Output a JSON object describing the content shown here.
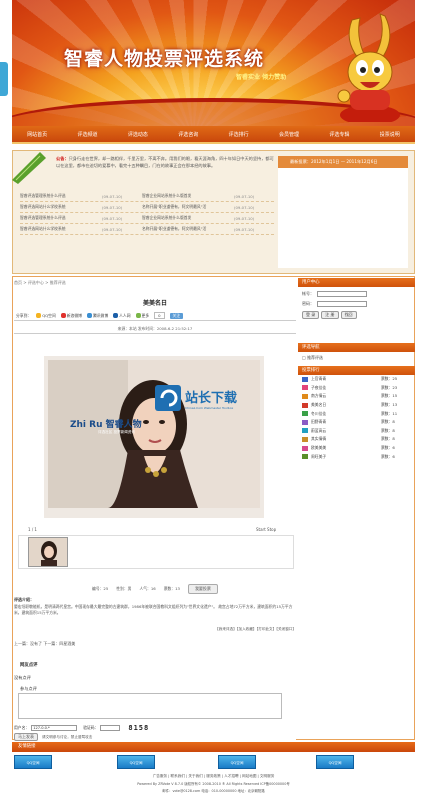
{
  "banner": {
    "title": "智睿人物投票评选系统",
    "subtitle": "智睿实业 倾力赞助"
  },
  "nav": [
    "网站首页",
    "评选频道",
    "评选动态",
    "评选咨询",
    "评选排行",
    "会员管理",
    "评选专辑",
    "投票说明"
  ],
  "notice": {
    "label": "公告：",
    "text": "只身行走在世界，却一路相伴，千里万里，不离不弃。用我们的眼，看天涯海角，四十年如日中天的坚持，都可以在这里，都市在迫切的爱慕中，看完十五种瞩目，门在的故事正会在那本经的故事。"
  },
  "latest_bar": "最新投票：2012年1月1日 — 2011年12月6日",
  "news": [
    [
      "智睿评选管理系统什么评选",
      "(09-07-10)",
      "智睿企业网站系统什么版首发",
      "(09-07-10)"
    ],
    [
      "智睿评选网站什么学校系统",
      "(09-07-10)",
      "名称开展\"职业道德有，阿文明最风\"活",
      "(09-07-10)"
    ],
    [
      "智睿评选管理系统什么评选",
      "(09-07-10)",
      "智睿企业网站系统什么版首发",
      "(09-07-10)"
    ],
    [
      "智睿评选网站什么学校系统",
      "(09-07-10)",
      "名称开展\"职业道德有，阿文明最风\"活",
      "(09-07-10)"
    ]
  ],
  "breadcrumb": "首页 > 评选中心 > 推荐评选",
  "work": {
    "title": "美美名日",
    "meta": "来源：本站   发布时间：2008-6-2 21:52:17"
  },
  "share": {
    "label": "分享到：",
    "items": [
      "QQ空间",
      "新浪微博",
      "腾讯微博",
      "人人网",
      "更多"
    ],
    "count": "0",
    "follow": "关注"
  },
  "watermark": {
    "brand": "站长下载",
    "sub": "Chinaz.Com Webmaster Toolbox",
    "logo_text": "Zhi Ru 智睿人物",
    "logo_sub": "评选社区  投票新闻资讯"
  },
  "slideshow": {
    "counter": "1 / 1",
    "start_stop": "Start Stop"
  },
  "vote": {
    "stats": [
      "编号：25",
      "性别：男",
      "人气：16",
      "票数：13"
    ],
    "button": "我要投票"
  },
  "intro": {
    "label": "评选介绍：",
    "text": "晏宏坦职敬能机，是明清两代皇宫。中国现存最大最完整的古建筑群，1986年被联合国教科文组织列为\"世界文化遗产\"。 故宫占地72万平方米，建筑面积约15万平方米。建筑面积15万平方米。",
    "links": "【我来评选】【加入收藏】【打印此文】【关闭窗口】"
  },
  "prevnext": "上一篇：没有了   下一篇：四星酒美",
  "review": {
    "title": "网友点评",
    "empty": "没有点评",
    "comment_label": "参与点评",
    "user_label": "用户名：",
    "user_value": "127.0.0.*",
    "code_label": "验证码：",
    "captcha": "8158",
    "submit": "马上发表",
    "hint": "请文明参与讨论，禁止谩骂攻击"
  },
  "right": {
    "login_head": "用户中心",
    "account_label": "帐号：",
    "password_label": "密码：",
    "buttons": [
      "登 录",
      "注 册",
      "找回"
    ],
    "cat_head": "评选导航",
    "cat_item": "推荐评选",
    "rank_head": "投票排行",
    "ranks": [
      {
        "name": "上官青青",
        "votes": "票数：25",
        "color": "#3a66c8"
      },
      {
        "name": "子夜佳佳",
        "votes": "票数：23",
        "color": "#e2447b"
      },
      {
        "name": "南方倩云",
        "votes": "票数：15",
        "color": "#e08a1a"
      },
      {
        "name": "美美名日",
        "votes": "票数：13",
        "color": "#d23a2a"
      },
      {
        "name": "冬川佳佳",
        "votes": "票数：11",
        "color": "#3aa148"
      },
      {
        "name": "田野青青",
        "votes": "票数：8",
        "color": "#8b5cc6"
      },
      {
        "name": "蔚蓝高云",
        "votes": "票数：8",
        "color": "#23a0c2"
      },
      {
        "name": "其实倩倩",
        "votes": "票数：8",
        "color": "#c98e2a"
      },
      {
        "name": "欧美美美",
        "votes": "票数：6",
        "color": "#d64a8e"
      },
      {
        "name": "周旺美子",
        "votes": "票数：6",
        "color": "#5a8f2a"
      }
    ]
  },
  "links_head": "友情链接",
  "friend_links": [
    "QQ空间",
    "QQ空间",
    "QQ空间",
    "QQ空间"
  ],
  "footer": {
    "links": "广告服务 | 联系我们 | 关于我们 | 服务政策 | 人才招聘 | 网站地图 | 文明服务",
    "power": "Powered By ZRVote V 8.7.0 版权所有© 2008-2010 ® All Rights Reserved ICP备00000000号",
    "contact": "邮件：vote@0128.com   电话：010-00000000   地址：北京朝阳路"
  },
  "colors": {
    "accent": "#e06a16",
    "header_red": "#c42a0a",
    "link_blue": "#1a7cc7"
  }
}
